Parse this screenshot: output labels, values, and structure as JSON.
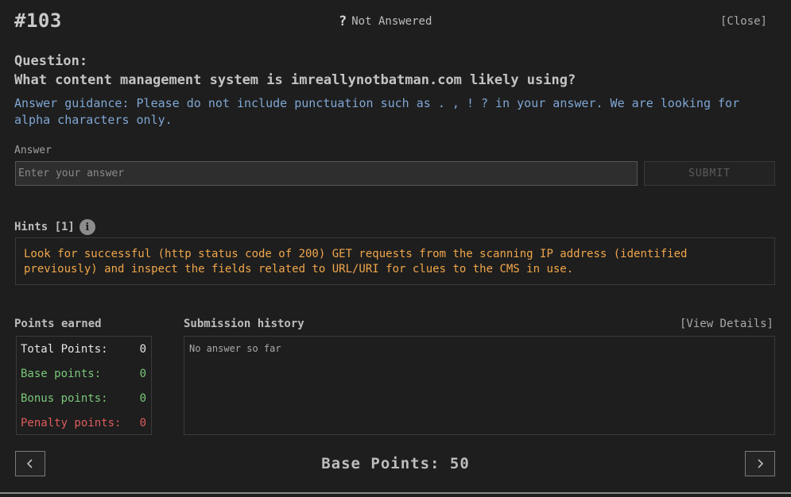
{
  "header": {
    "question_number": "#103",
    "status_icon": "?",
    "status_text": "Not Answered",
    "close_label": "[Close]"
  },
  "question": {
    "label": "Question:",
    "text": "What content management system is imreallynotbatman.com likely using?",
    "guidance": "Answer guidance: Please do not include punctuation such as . , ! ? in your answer. We are looking for alpha characters only."
  },
  "answer": {
    "label": "Answer",
    "placeholder": "Enter your answer",
    "value": "",
    "submit_label": "SUBMIT"
  },
  "hints": {
    "label": "Hints [1]",
    "icon": "info-icon",
    "text": "Look for successful (http status code of 200) GET requests from the scanning IP address (identified previously) and inspect the fields related to URL/URI for clues to the CMS in use."
  },
  "points": {
    "label": "Points earned",
    "rows": [
      {
        "label": "Total Points:",
        "value": "0"
      },
      {
        "label": "Base points:",
        "value": "0"
      },
      {
        "label": "Bonus points:",
        "value": "0"
      },
      {
        "label": "Penalty points:",
        "value": "0"
      }
    ]
  },
  "history": {
    "label": "Submission history",
    "view_details_label": "[View Details]",
    "empty_text": "No answer so far"
  },
  "footer": {
    "base_points": "Base Points: 50",
    "prev_icon": "chevron-left-icon",
    "next_icon": "chevron-right-icon"
  },
  "colors": {
    "background": "#1e1e1e",
    "guidance": "#7fa7d4",
    "hint": "#f0a64a",
    "positive": "#7ac77a",
    "penalty": "#e05c5c"
  }
}
